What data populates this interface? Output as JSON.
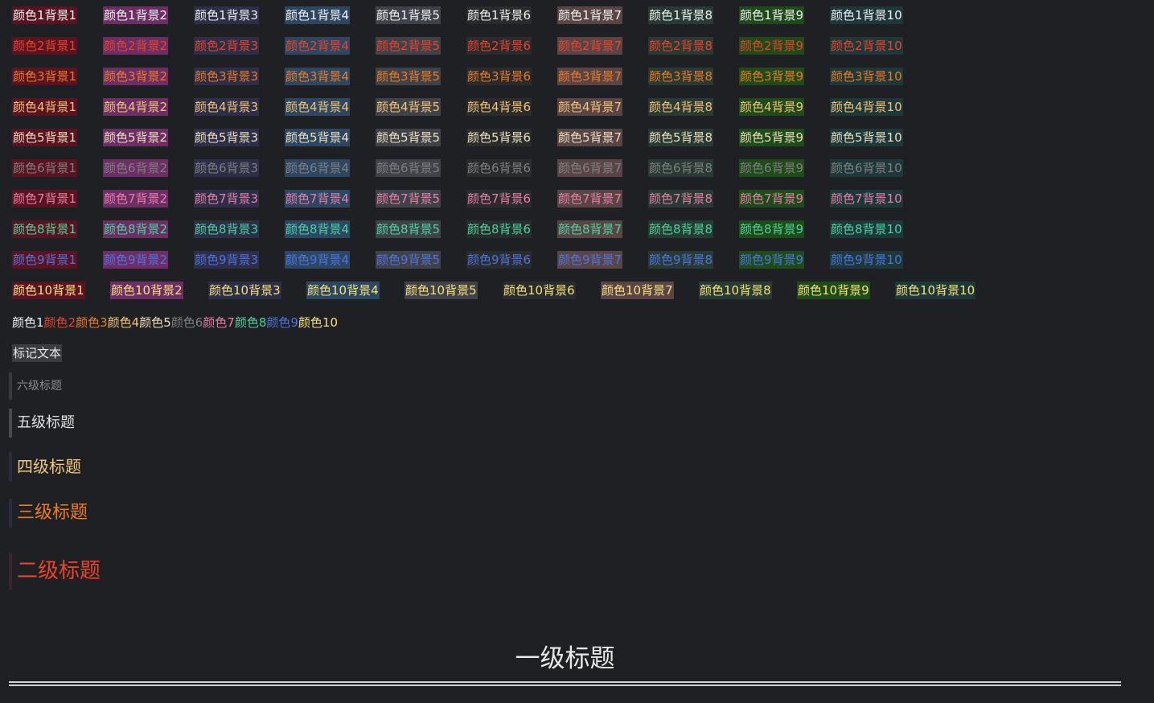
{
  "fg_colors": [
    "#f0f0f0",
    "#e8432b",
    "#ed7a20",
    "#f4c273",
    "#eedfbe",
    "#7f7f7f",
    "#e97ea6",
    "#4bd29e",
    "#4c74e2",
    "#f6e177"
  ],
  "bg_colors": [
    "#5a1421",
    "#6d2e66",
    "#2d2e48",
    "#2d4762",
    "#404249",
    "#292b2d",
    "#5a4546",
    "#283a33",
    "#1f4a1a",
    "#1e3839"
  ],
  "grid": [
    [
      "颜色1背景1",
      "颜色1背景2",
      "颜色1背景3",
      "颜色1背景4",
      "颜色1背景5",
      "颜色1背景6",
      "颜色1背景7",
      "颜色1背景8",
      "颜色1背景9",
      "颜色1背景10"
    ],
    [
      "颜色2背景1",
      "颜色2背景2",
      "颜色2背景3",
      "颜色2背景4",
      "颜色2背景5",
      "颜色2背景6",
      "颜色2背景7",
      "颜色2背景8",
      "颜色2背景9",
      "颜色2背景10"
    ],
    [
      "颜色3背景1",
      "颜色3背景2",
      "颜色3背景3",
      "颜色3背景4",
      "颜色3背景5",
      "颜色3背景6",
      "颜色3背景7",
      "颜色3背景8",
      "颜色3背景9",
      "颜色3背景10"
    ],
    [
      "颜色4背景1",
      "颜色4背景2",
      "颜色4背景3",
      "颜色4背景4",
      "颜色4背景5",
      "颜色4背景6",
      "颜色4背景7",
      "颜色4背景8",
      "颜色4背景9",
      "颜色4背景10"
    ],
    [
      "颜色5背景1",
      "颜色5背景2",
      "颜色5背景3",
      "颜色5背景4",
      "颜色5背景5",
      "颜色5背景6",
      "颜色5背景7",
      "颜色5背景8",
      "颜色5背景9",
      "颜色5背景10"
    ],
    [
      "颜色6背景1",
      "颜色6背景2",
      "颜色6背景3",
      "颜色6背景4",
      "颜色6背景5",
      "颜色6背景6",
      "颜色6背景7",
      "颜色6背景8",
      "颜色6背景9",
      "颜色6背景10"
    ],
    [
      "颜色7背景1",
      "颜色7背景2",
      "颜色7背景3",
      "颜色7背景4",
      "颜色7背景5",
      "颜色7背景6",
      "颜色7背景7",
      "颜色7背景8",
      "颜色7背景9",
      "颜色7背景10"
    ],
    [
      "颜色8背景1",
      "颜色8背景2",
      "颜色8背景3",
      "颜色8背景4",
      "颜色8背景5",
      "颜色8背景6",
      "颜色8背景7",
      "颜色8背景8",
      "颜色8背景9",
      "颜色8背景10"
    ],
    [
      "颜色9背景1",
      "颜色9背景2",
      "颜色9背景3",
      "颜色9背景4",
      "颜色9背景5",
      "颜色9背景6",
      "颜色9背景7",
      "颜色9背景8",
      "颜色9背景9",
      "颜色9背景10"
    ],
    [
      "颜色10背景1",
      "颜色10背景2",
      "颜色10背景3",
      "颜色10背景4",
      "颜色10背景5",
      "颜色10背景6",
      "颜色10背景7",
      "颜色10背景8",
      "颜色10背景9",
      "颜色10背景10"
    ]
  ],
  "mixed_text": [
    "颜色1",
    "颜色2",
    "颜色3",
    "颜色4",
    "颜色5",
    "颜色6",
    "颜色7",
    "颜色8",
    "颜色9",
    "颜色10"
  ],
  "mark_text": "标记文本",
  "headings": {
    "h6": "六级标题",
    "h5": "五级标题",
    "h4": "四级标题",
    "h3": "三级标题",
    "h2": "二级标题",
    "h1": "一级标题"
  }
}
